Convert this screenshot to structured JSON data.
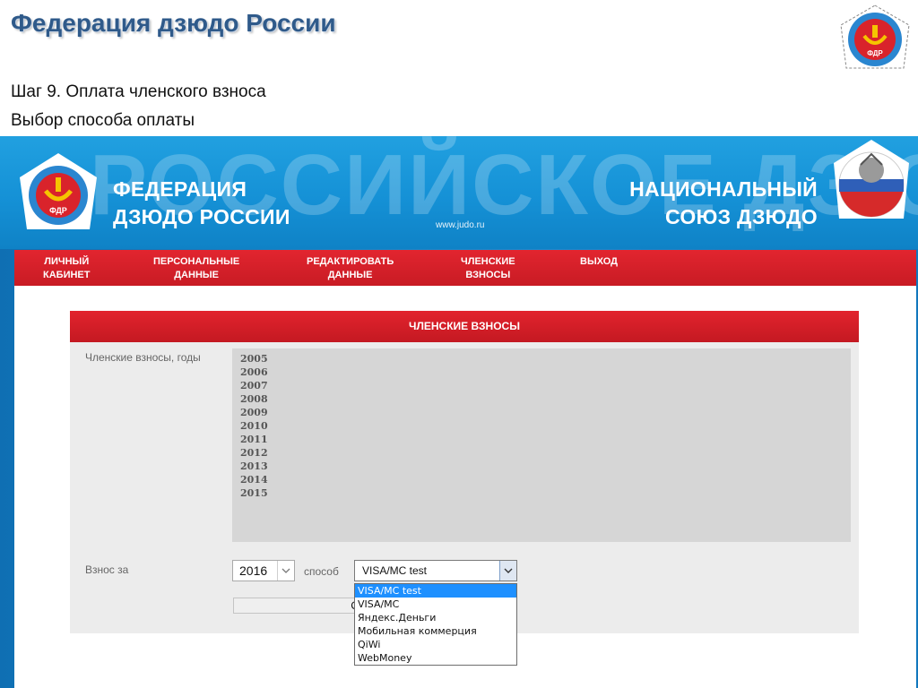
{
  "slide": {
    "title": "Федерация дзюдо России",
    "step_line1": "Шаг 9. Оплата членского взноса",
    "step_line2": "Выбор способа оплаты"
  },
  "banner": {
    "bg_text": "РОССИЙСКОЕ ДЗЮДО",
    "left_line1": "ФЕДЕРАЦИЯ",
    "left_line2": "ДЗЮДО РОССИИ",
    "url": "www.judo.ru",
    "right_line1": "НАЦИОНАЛЬНЫЙ",
    "right_line2": "СОЮЗ ДЗЮДО",
    "logo_text": "ФДР"
  },
  "nav": {
    "items": [
      {
        "line1": "ЛИЧНЫЙ",
        "line2": "КАБИНЕТ"
      },
      {
        "line1": "ПЕРСОНАЛЬНЫЕ",
        "line2": "ДАННЫЕ"
      },
      {
        "line1": "РЕДАКТИРОВАТЬ",
        "line2": "ДАННЫЕ"
      },
      {
        "line1": "ЧЛЕНСКИЕ",
        "line2": "ВЗНОСЫ"
      },
      {
        "line1": "ВЫХОД",
        "line2": ""
      }
    ]
  },
  "panel": {
    "header": "ЧЛЕНСКИЕ ВЗНОСЫ",
    "years_label": "Членские взносы, годы",
    "years": [
      "2005",
      "2006",
      "2007",
      "2008",
      "2009",
      "2010",
      "2011",
      "2012",
      "2013",
      "2014",
      "2015"
    ],
    "fee_label": "Взнос за",
    "year_value": "2016",
    "method_label": "способ",
    "method_value": "VISA/MC test",
    "pay_button": "Оплатить"
  },
  "dropdown": {
    "options": [
      "VISA/MC test",
      "VISA/MC",
      "Яндекс.Деньги",
      "Мобильная коммерция",
      "QiWi",
      "WebMoney"
    ]
  },
  "colors": {
    "nav_red": "#c81b24",
    "banner_blue": "#1591d6",
    "selected_option": "#1e90ff"
  }
}
